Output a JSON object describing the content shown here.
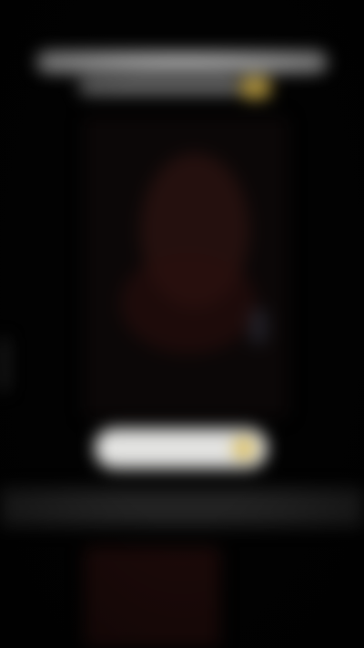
{
  "header": {
    "headline": "",
    "subline": ""
  },
  "cta": {
    "label": ""
  },
  "colors": {
    "background": "#020202",
    "headline": "#b9b9b9",
    "accent": "#d7b54c",
    "poster_tone": "#3a1714",
    "cta_background": "#f0f0ee",
    "strip": "#222222"
  },
  "icons": {
    "cta_icon": "circle-accent-icon"
  }
}
